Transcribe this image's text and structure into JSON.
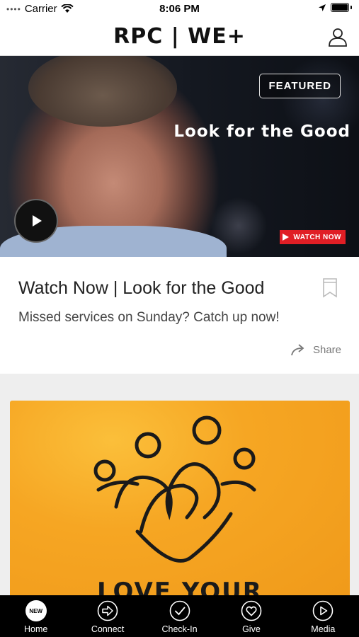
{
  "status": {
    "carrier": "Carrier",
    "time": "8:06 PM"
  },
  "header": {
    "logo": "RPC | WE+"
  },
  "hero": {
    "badge": "FEATURED",
    "title": "Look for the Good",
    "watch_badge": "WATCH NOW"
  },
  "card": {
    "title": "Watch Now | Look for the Good",
    "subtitle": "Missed services on Sunday? Catch up now!",
    "share_label": "Share"
  },
  "promo": {
    "text": "LOVE YOUR"
  },
  "tabs": [
    {
      "label": "Home",
      "icon": "new-icon",
      "badge": "NEW"
    },
    {
      "label": "Connect",
      "icon": "arrow-circle-icon"
    },
    {
      "label": "Check-In",
      "icon": "check-circle-icon"
    },
    {
      "label": "Give",
      "icon": "heart-circle-icon"
    },
    {
      "label": "Media",
      "icon": "play-circle-icon"
    }
  ],
  "colors": {
    "accent": "#e01e25",
    "promo_bg": "#f6a623",
    "tabbar": "#000000"
  }
}
